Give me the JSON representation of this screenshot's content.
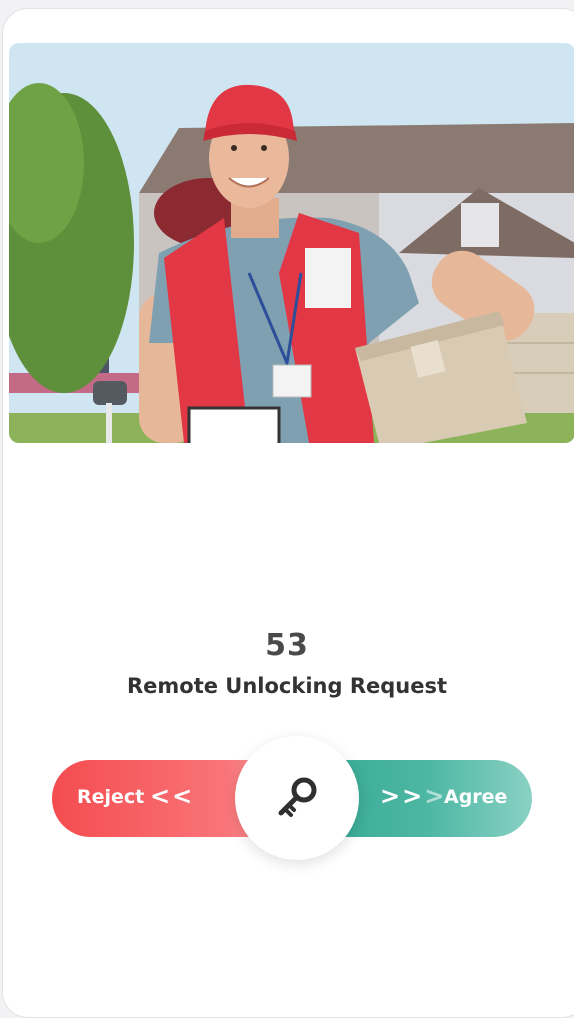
{
  "request": {
    "countdown": "53",
    "title": "Remote Unlocking Request"
  },
  "slider": {
    "reject_label": "Reject",
    "reject_arrows": "<<",
    "agree_arrows": ">>",
    "agree_arrow_dim": ">",
    "agree_label": "Agree",
    "knob_icon": "key-icon"
  },
  "colors": {
    "reject": "#f44c4f",
    "agree": "#34a893",
    "text": "#333333"
  }
}
